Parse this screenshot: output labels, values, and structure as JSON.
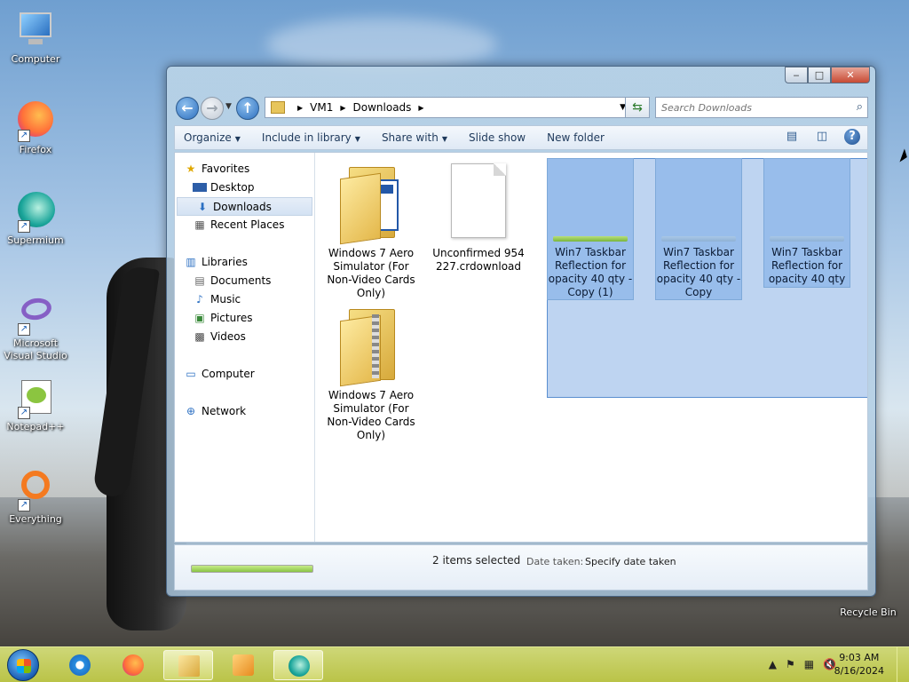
{
  "desktop": {
    "icons": [
      {
        "label": "Computer"
      },
      {
        "label": "Firefox"
      },
      {
        "label": "Supermium"
      },
      {
        "label": "Microsoft Visual Studio"
      },
      {
        "label": "Notepad++"
      },
      {
        "label": "Everything"
      }
    ],
    "recycle_bin": "Recycle Bin"
  },
  "window": {
    "caption": {
      "minimize": "‒",
      "maximize": "□",
      "close": "✕"
    },
    "address": {
      "root": "VM1",
      "current": "Downloads"
    },
    "search": {
      "placeholder": "Search Downloads"
    },
    "toolbar": {
      "organize": "Organize",
      "include": "Include in library",
      "share": "Share with",
      "slideshow": "Slide show",
      "new_folder": "New folder"
    },
    "nav_pane": {
      "favorites": "Favorites",
      "desktop": "Desktop",
      "downloads": "Downloads",
      "recent": "Recent Places",
      "libraries": "Libraries",
      "documents": "Documents",
      "music": "Music",
      "pictures": "Pictures",
      "videos": "Videos",
      "computer": "Computer",
      "network": "Network"
    },
    "files": [
      {
        "name": "Windows 7 Aero Simulator (For Non-Video Cards Only)",
        "type": "folder"
      },
      {
        "name": "Unconfirmed 954227.crdownload",
        "type": "file"
      },
      {
        "name": "Win7 Taskbar Reflection for opacity 40 qty - Copy (1)",
        "type": "image",
        "selected": true
      },
      {
        "name": "Win7 Taskbar Reflection for opacity 40 qty - Copy",
        "type": "image",
        "selected": true
      },
      {
        "name": "Win7 Taskbar Reflection for opacity 40 qty",
        "type": "image",
        "selected": true
      },
      {
        "name": "Windows 7 Aero Simulator (For Non-Video Cards Only)",
        "type": "zip"
      }
    ],
    "details": {
      "count": "2 items selected",
      "date_label": "Date taken:",
      "date_value": "Specify date taken"
    }
  },
  "taskbar": {
    "time": "9:03 AM",
    "date": "8/16/2024"
  },
  "colors": {
    "selection": "#8fb6e6",
    "taskbar": "#c8d060"
  }
}
